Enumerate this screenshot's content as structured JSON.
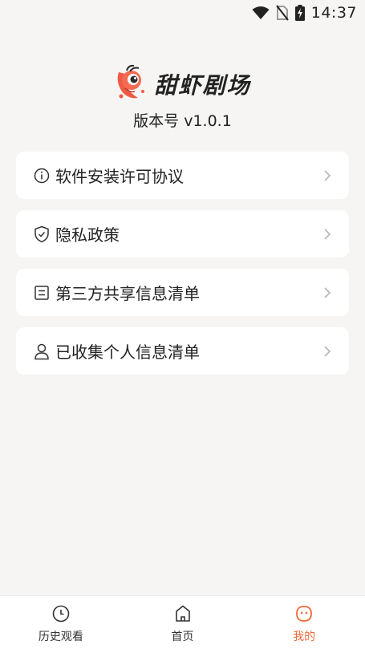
{
  "status_bar": {
    "time": "14:37",
    "icons": [
      "wifi-icon",
      "no-sim-icon",
      "battery-charging-icon"
    ]
  },
  "header": {
    "app_name": "甜虾剧场",
    "version": "版本号 v1.0.1",
    "logo_icon": "shrimp-logo-icon"
  },
  "menu": {
    "items": [
      {
        "label": "软件安装许可协议",
        "icon": "info-icon"
      },
      {
        "label": "隐私政策",
        "icon": "shield-check-icon"
      },
      {
        "label": "第三方共享信息清单",
        "icon": "document-list-icon"
      },
      {
        "label": "已收集个人信息清单",
        "icon": "user-icon"
      }
    ]
  },
  "tab_bar": {
    "tabs": [
      {
        "label": "历史观看",
        "icon": "clock-icon"
      },
      {
        "label": "首页",
        "icon": "home-icon"
      },
      {
        "label": "我的",
        "icon": "profile-face-icon",
        "active": true
      }
    ]
  },
  "colors": {
    "accent": "#ef6a37",
    "background": "#f6f5f3",
    "card": "#ffffff"
  }
}
